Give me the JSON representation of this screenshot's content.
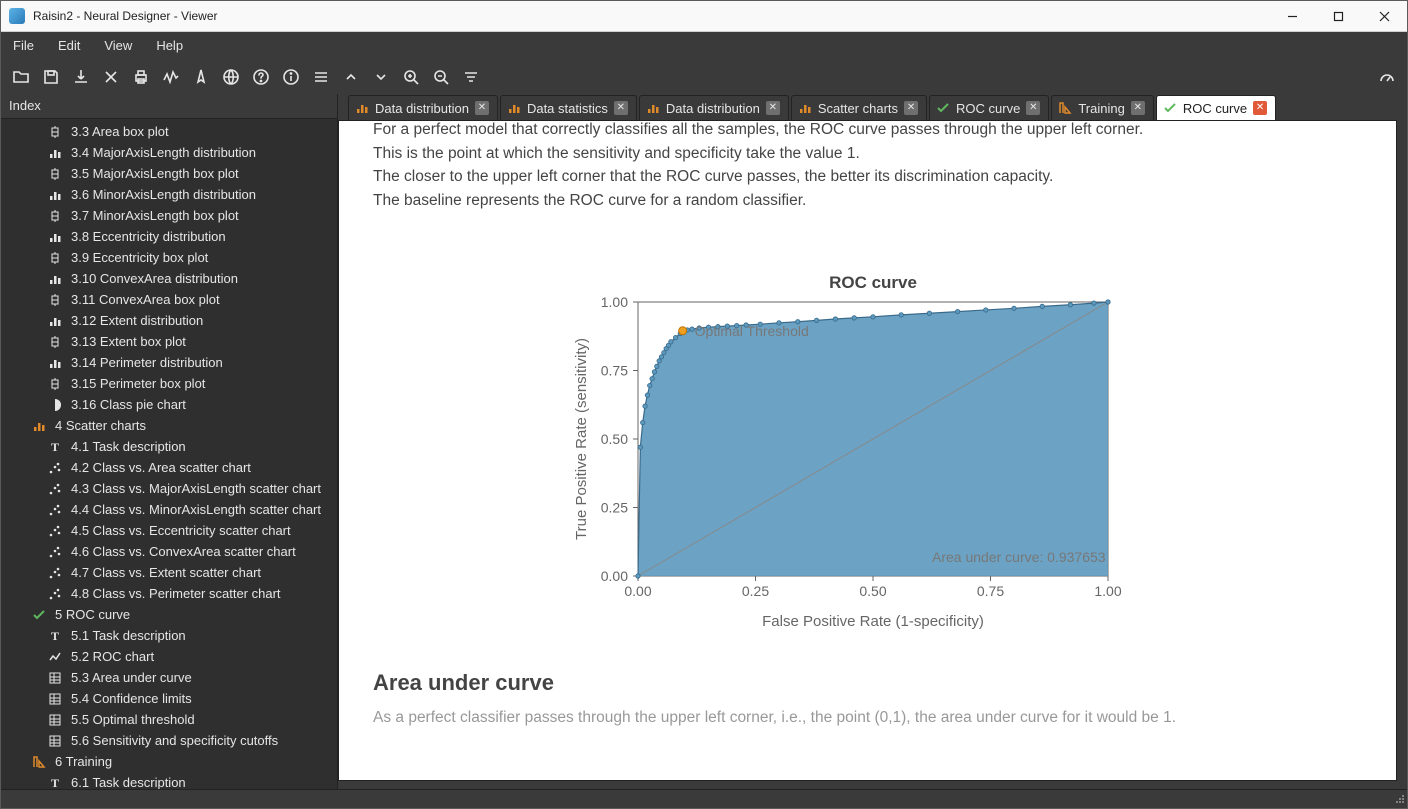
{
  "window": {
    "title": "Raisin2 - Neural Designer - Viewer"
  },
  "menu": [
    "File",
    "Edit",
    "View",
    "Help"
  ],
  "sidebar": {
    "header": "Index",
    "items": [
      {
        "icon": "box",
        "label": "3.3 Area box plot",
        "lvl": 2
      },
      {
        "icon": "bars",
        "label": "3.4 MajorAxisLength distribution",
        "lvl": 2
      },
      {
        "icon": "box",
        "label": "3.5 MajorAxisLength box plot",
        "lvl": 2
      },
      {
        "icon": "bars",
        "label": "3.6 MinorAxisLength distribution",
        "lvl": 2
      },
      {
        "icon": "box",
        "label": "3.7 MinorAxisLength box plot",
        "lvl": 2
      },
      {
        "icon": "bars",
        "label": "3.8 Eccentricity distribution",
        "lvl": 2
      },
      {
        "icon": "box",
        "label": "3.9 Eccentricity box plot",
        "lvl": 2
      },
      {
        "icon": "bars",
        "label": "3.10 ConvexArea distribution",
        "lvl": 2
      },
      {
        "icon": "box",
        "label": "3.11 ConvexArea box plot",
        "lvl": 2
      },
      {
        "icon": "bars",
        "label": "3.12 Extent distribution",
        "lvl": 2
      },
      {
        "icon": "box",
        "label": "3.13 Extent box plot",
        "lvl": 2
      },
      {
        "icon": "bars",
        "label": "3.14 Perimeter distribution",
        "lvl": 2
      },
      {
        "icon": "box",
        "label": "3.15 Perimeter box plot",
        "lvl": 2
      },
      {
        "icon": "pie",
        "label": "3.16 Class pie chart",
        "lvl": 2
      },
      {
        "icon": "scatter-o",
        "label": "4 Scatter charts",
        "lvl": 1
      },
      {
        "icon": "text",
        "label": "4.1 Task description",
        "lvl": 2
      },
      {
        "icon": "dots",
        "label": "4.2 Class vs. Area scatter chart",
        "lvl": 2
      },
      {
        "icon": "dots",
        "label": "4.3 Class vs. MajorAxisLength scatter chart",
        "lvl": 2
      },
      {
        "icon": "dots",
        "label": "4.4 Class vs. MinorAxisLength scatter chart",
        "lvl": 2
      },
      {
        "icon": "dots",
        "label": "4.5 Class vs. Eccentricity scatter chart",
        "lvl": 2
      },
      {
        "icon": "dots",
        "label": "4.6 Class vs. ConvexArea scatter chart",
        "lvl": 2
      },
      {
        "icon": "dots",
        "label": "4.7 Class vs. Extent scatter chart",
        "lvl": 2
      },
      {
        "icon": "dots",
        "label": "4.8 Class vs. Perimeter scatter chart",
        "lvl": 2
      },
      {
        "icon": "check",
        "label": "5 ROC curve",
        "lvl": 1
      },
      {
        "icon": "text",
        "label": "5.1 Task description",
        "lvl": 2
      },
      {
        "icon": "line",
        "label": "5.2 ROC chart",
        "lvl": 2
      },
      {
        "icon": "table",
        "label": "5.3 Area under curve",
        "lvl": 2
      },
      {
        "icon": "table",
        "label": "5.4 Confidence limits",
        "lvl": 2
      },
      {
        "icon": "table",
        "label": "5.5 Optimal threshold",
        "lvl": 2
      },
      {
        "icon": "table",
        "label": "5.6 Sensitivity and specificity cutoffs",
        "lvl": 2
      },
      {
        "icon": "training",
        "label": "6 Training",
        "lvl": 1
      },
      {
        "icon": "text",
        "label": "6.1 Task description",
        "lvl": 2
      }
    ]
  },
  "tabs": [
    {
      "icon": "bars-o",
      "label": "Data distribution",
      "active": false
    },
    {
      "icon": "bars-o",
      "label": "Data statistics",
      "active": false
    },
    {
      "icon": "bars-o",
      "label": "Data distribution",
      "active": false
    },
    {
      "icon": "scatter-o",
      "label": "Scatter charts",
      "active": false
    },
    {
      "icon": "check",
      "label": "ROC curve",
      "active": false
    },
    {
      "icon": "training",
      "label": "Training",
      "active": false
    },
    {
      "icon": "check",
      "label": "ROC curve",
      "active": true
    }
  ],
  "doc": {
    "p1": "For a perfect model that correctly classifies all the samples, the ROC curve passes through the upper left corner.",
    "p2": "This is the point at which the sensitivity and specificity take the value 1.",
    "p3": "The closer to the upper left corner that the ROC curve passes, the better its discrimination capacity.",
    "p4": "The baseline represents the ROC curve for a random classifier.",
    "h2": "Area under curve",
    "p5": "As a perfect classifier passes through the upper left corner, i.e., the point (0,1), the area under curve for it would be 1."
  },
  "chart_data": {
    "type": "line",
    "title": "ROC curve",
    "xlabel": "False Positive Rate (1-specificity)",
    "ylabel": "True Positive Rate (sensitivity)",
    "xlim": [
      0,
      1
    ],
    "ylim": [
      0,
      1
    ],
    "xticks": [
      0.0,
      0.25,
      0.5,
      0.75,
      1.0
    ],
    "yticks": [
      0.0,
      0.25,
      0.5,
      0.75,
      1.0
    ],
    "annotations": [
      {
        "text": "Optimal Threshold",
        "x": 0.095,
        "y": 0.895,
        "marker": "orange"
      },
      {
        "text": "Area under curve: 0.937653",
        "x": 0.6,
        "y": 0.07
      }
    ],
    "baseline": {
      "x": [
        0,
        1
      ],
      "y": [
        0,
        1
      ]
    },
    "series": [
      {
        "name": "ROC",
        "fill": true,
        "x": [
          0.0,
          0.005,
          0.01,
          0.015,
          0.02,
          0.025,
          0.03,
          0.035,
          0.04,
          0.045,
          0.05,
          0.055,
          0.06,
          0.065,
          0.07,
          0.08,
          0.09,
          0.095,
          0.105,
          0.115,
          0.13,
          0.15,
          0.17,
          0.19,
          0.21,
          0.23,
          0.26,
          0.3,
          0.34,
          0.38,
          0.42,
          0.46,
          0.5,
          0.56,
          0.62,
          0.68,
          0.74,
          0.8,
          0.86,
          0.92,
          0.97,
          1.0
        ],
        "y": [
          0.0,
          0.47,
          0.56,
          0.62,
          0.66,
          0.695,
          0.72,
          0.745,
          0.765,
          0.785,
          0.8,
          0.815,
          0.83,
          0.842,
          0.855,
          0.87,
          0.885,
          0.895,
          0.898,
          0.901,
          0.905,
          0.908,
          0.91,
          0.912,
          0.914,
          0.916,
          0.919,
          0.924,
          0.928,
          0.933,
          0.938,
          0.942,
          0.946,
          0.953,
          0.959,
          0.965,
          0.971,
          0.977,
          0.984,
          0.99,
          0.996,
          1.0
        ]
      }
    ]
  }
}
